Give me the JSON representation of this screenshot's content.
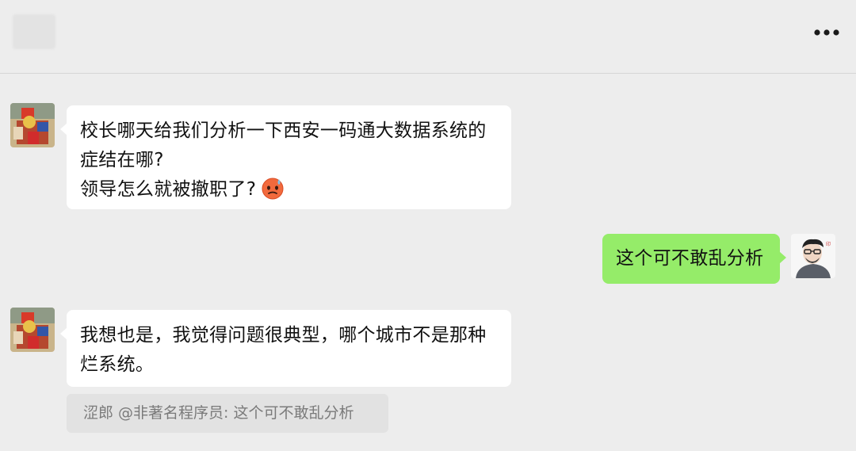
{
  "header": {
    "more_icon": "more-horizontal-icon"
  },
  "messages": [
    {
      "side": "left",
      "avatar": "avatar-jester-figure",
      "lines": [
        "校长哪天给我们分析一下西安一码通大数据系统的",
        "症结在哪?",
        "领导怎么就被撤职了?"
      ],
      "emoji": "sweat-face-emoji"
    },
    {
      "side": "right",
      "avatar": "avatar-glasses-man",
      "lines": [
        "这个可不敢乱分析"
      ]
    },
    {
      "side": "left",
      "avatar": "avatar-jester-figure",
      "lines": [
        "我想也是，我觉得问题很典型，哪个城市不是那种",
        "烂系统。"
      ]
    }
  ],
  "quote": {
    "text": "涩郎 @非著名程序员: 这个可不敢乱分析"
  },
  "colors": {
    "background": "#ededed",
    "bubble_left": "#ffffff",
    "bubble_right": "#95ec69",
    "quote_bg": "#e2e2e2",
    "quote_text": "#7a7a7a"
  }
}
